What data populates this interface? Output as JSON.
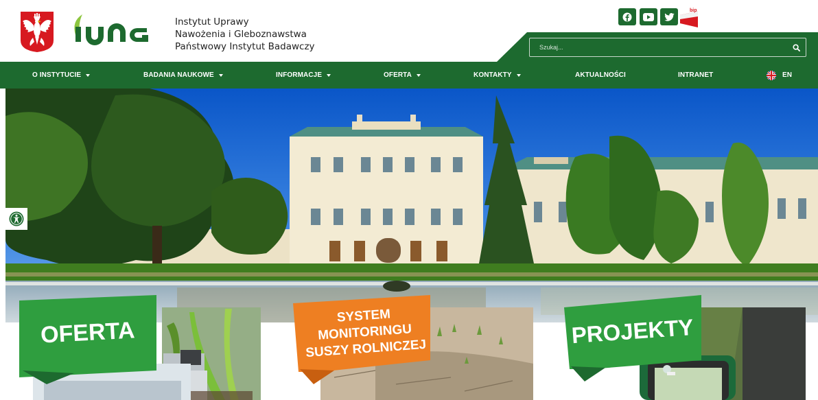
{
  "header": {
    "institute_lines": [
      "Instytut Uprawy",
      "Nawożenia i Gleboznawstwa",
      "Państwowy Instytut Badawczy"
    ],
    "logo_text": "IUNG",
    "bip_label": "bip"
  },
  "social": [
    {
      "name": "facebook",
      "icon": "facebook-icon"
    },
    {
      "name": "youtube",
      "icon": "youtube-icon"
    },
    {
      "name": "twitter",
      "icon": "twitter-icon"
    }
  ],
  "search": {
    "placeholder": "Szukaj..."
  },
  "nav": {
    "items": [
      {
        "label": "O INSTYTUCIE",
        "dropdown": true
      },
      {
        "label": "BADANIA NAUKOWE",
        "dropdown": true
      },
      {
        "label": "INFORMACJE",
        "dropdown": true
      },
      {
        "label": "OFERTA",
        "dropdown": true
      },
      {
        "label": "KONTAKTY",
        "dropdown": true
      },
      {
        "label": "AKTUALNOŚCI",
        "dropdown": false
      },
      {
        "label": "INTRANET",
        "dropdown": false
      }
    ],
    "language": "EN"
  },
  "cards": [
    {
      "lines": [
        "OFERTA"
      ],
      "color": "#2f9e3f"
    },
    {
      "lines": [
        "SYSTEM",
        "MONITORINGU",
        "SUSZY ROLNICZEJ"
      ],
      "color": "#ee7f22"
    },
    {
      "lines": [
        "PROJEKTY"
      ],
      "color": "#2f9e3f"
    }
  ],
  "colors": {
    "brand_green": "#1d6a2f",
    "logo_green": "#8dc63f",
    "accent_orange": "#ee7f22",
    "card_green": "#2f9e3f"
  }
}
